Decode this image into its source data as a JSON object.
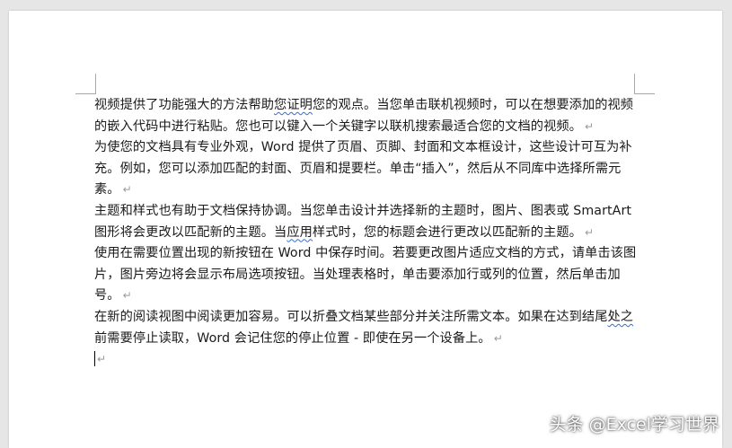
{
  "document": {
    "paragraphs": [
      {
        "segments": [
          {
            "text": "视频提供了功能强大的方法帮助"
          },
          {
            "text": "您证明",
            "spell": true
          },
          {
            "text": "您的观点。当您单击联机视频时，可以在想要添加的视频的嵌入代码中进行粘贴。您也可以键入一个关键字以联机搜索最适合您的文档的视频。"
          }
        ]
      },
      {
        "segments": [
          {
            "text": "为使您的文档具有专业外观，Word 提供了页眉、页脚、封面和文本框设计，这些设计可互为补充。例如，您可以添加匹配的封面、页眉和提要栏。单击“插入”，然后从不同库中选择所需元素。"
          }
        ]
      },
      {
        "segments": [
          {
            "text": "主题和样式也有助于文档保持协调。当您单击设计并选择新的主题时，图片、图表或 SmartArt 图形将会更改以匹配新的主题。当"
          },
          {
            "text": "应用",
            "spell": true
          },
          {
            "text": "样式时，您的标题会进行更改以匹配新的主题。"
          }
        ]
      },
      {
        "segments": [
          {
            "text": "使用在需要位置出现的新按钮在 Word 中保存时间。若要更改图片适应文档的方式，请单击该图片，图片旁边将会显示布局选项按钮。当处理表格时，单击要添加行或列的位置，然后单击加号。"
          }
        ]
      },
      {
        "segments": [
          {
            "text": "在新的阅读视图中阅读更加容易。可以折叠文档某些部分并关注所需文本。如果在达到结尾"
          },
          {
            "text": "处之",
            "spell": true
          },
          {
            "text": "前需要停止读取，Word 会记住您的停止位置 - 即使在另一个设备上。"
          }
        ]
      }
    ],
    "paragraph_mark": "↵"
  },
  "watermark": "头条 @Excel学习世界",
  "colors": {
    "background": "#e6e6e6",
    "page": "#ffffff",
    "spell_underline": "#2f6fd6"
  }
}
